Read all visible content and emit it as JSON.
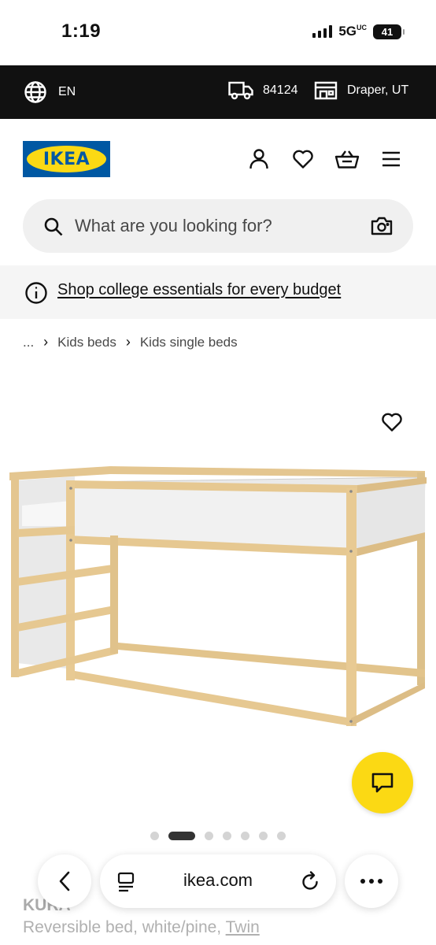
{
  "status": {
    "time": "1:19",
    "network": "5G",
    "network_suffix": "UC",
    "battery": "41"
  },
  "topbar": {
    "language": "EN",
    "zip": "84124",
    "store": "Draper, UT"
  },
  "header": {
    "logo_text": "IKEA",
    "icons": [
      "account-icon",
      "heart-icon",
      "basket-icon",
      "menu-icon"
    ]
  },
  "search": {
    "placeholder": "What are you looking for?"
  },
  "promo": {
    "text": "Shop college essentials for every budget"
  },
  "breadcrumb": {
    "ellipsis": "...",
    "items": [
      "Kids beds",
      "Kids single beds"
    ]
  },
  "carousel": {
    "dot_count": 7,
    "active_index": 1
  },
  "product": {
    "name": "KURA",
    "description": "Reversible bed, white/pine, ",
    "size_link": "Twin"
  },
  "browser": {
    "url": "ikea.com"
  },
  "colors": {
    "ikea_blue": "#0058a3",
    "ikea_yellow": "#fbd914",
    "topbar_bg": "#111111"
  }
}
